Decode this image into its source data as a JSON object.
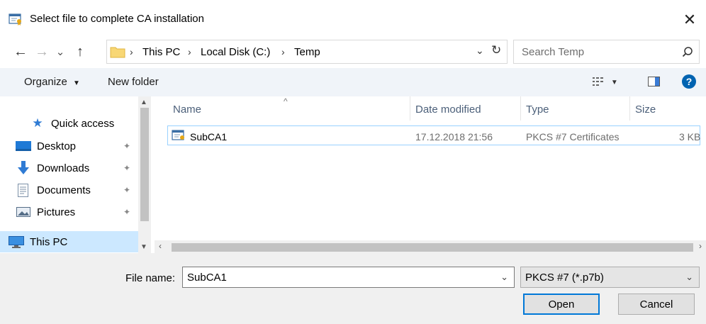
{
  "window": {
    "title": "Select file to complete CA installation",
    "close_glyph": "✕"
  },
  "nav": {
    "back_glyph": "←",
    "forward_glyph": "→",
    "recent_glyph": "⌄",
    "up_glyph": "↑",
    "breadcrumb": [
      "This PC",
      "Local Disk (C:)",
      "Temp"
    ],
    "separator": "›",
    "dropdown_glyph": "⌄",
    "refresh_glyph": "↻"
  },
  "search": {
    "placeholder": "Search Temp"
  },
  "toolbar": {
    "organize_label": "Organize",
    "organize_arrow": "▼",
    "new_folder_label": "New folder",
    "views_arrow": "▼",
    "help_glyph": "?"
  },
  "sidebar": {
    "items": [
      {
        "label": "Quick access",
        "icon": "star-icon"
      },
      {
        "label": "Desktop",
        "icon": "desktop-icon"
      },
      {
        "label": "Downloads",
        "icon": "download-icon"
      },
      {
        "label": "Documents",
        "icon": "documents-icon"
      },
      {
        "label": "Pictures",
        "icon": "pictures-icon"
      },
      {
        "label": "This PC",
        "icon": "computer-icon"
      }
    ],
    "pin_glyph": "📌"
  },
  "filelist": {
    "columns": [
      "Name",
      "Date modified",
      "Type",
      "Size"
    ],
    "sort_glyph": "^",
    "rows": [
      {
        "name": "SubCA1",
        "date": "17.12.2018 21:56",
        "type": "PKCS #7 Certificates",
        "size": "3 KB"
      }
    ]
  },
  "bottom": {
    "filename_label": "File name:",
    "filename_value": "SubCA1",
    "filetype_value": "PKCS #7 (*.p7b)",
    "open_label": "Open",
    "cancel_label": "Cancel",
    "dropdown_glyph": "⌄"
  },
  "colors": {
    "accent": "#0078d7",
    "selection": "#cce8ff",
    "toolbar_bg": "#f0f4f9",
    "help": "#0063b1"
  }
}
